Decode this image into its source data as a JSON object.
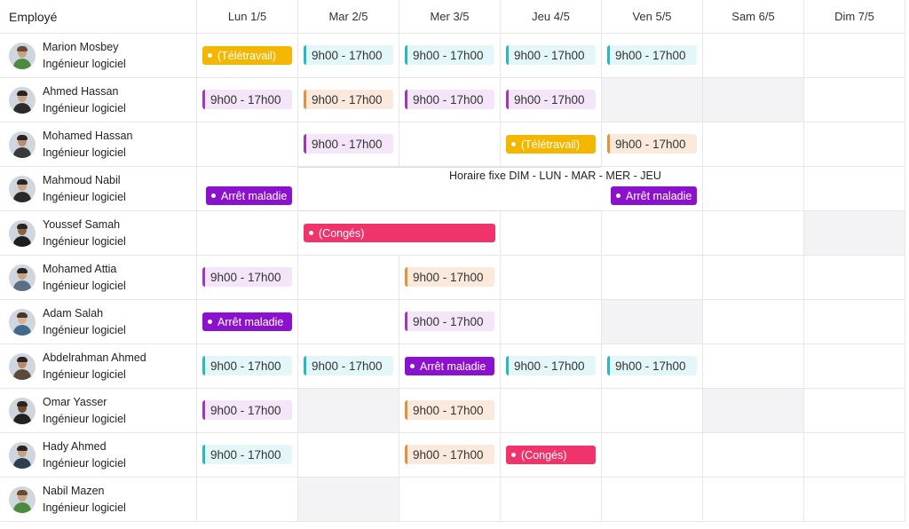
{
  "header": {
    "employee_label": "Employé",
    "days": [
      "Lun 1/5",
      "Mar 2/5",
      "Mer 3/5",
      "Jeu 4/5",
      "Ven 5/5",
      "Sam 6/5",
      "Dim 7/5"
    ]
  },
  "role": "Ingénieur logiciel",
  "employees": [
    {
      "name": "Marion Mosbey"
    },
    {
      "name": "Ahmed Hassan"
    },
    {
      "name": "Mohamed Hassan"
    },
    {
      "name": "Mahmoud Nabil"
    },
    {
      "name": "Youssef Samah"
    },
    {
      "name": "Mohamed Attia"
    },
    {
      "name": "Adam Salah"
    },
    {
      "name": "Abdelrahman Ahmed"
    },
    {
      "name": "Omar Yasser"
    },
    {
      "name": "Hady Ahmed"
    },
    {
      "name": "Nabil Mazen"
    }
  ],
  "labels": {
    "shift": "9h00 - 17h00",
    "telework": "(Télétravail)",
    "sick": "Arrêt maladie",
    "leave": "(Congés)",
    "fixed_schedule": "Horaire fixe DIM - LUN - MAR - MER - JEU"
  },
  "colors": {
    "shift_cyan": "#2bb7c2",
    "shift_purple": "#9b3ab5",
    "shift_orange": "#e0933d",
    "telework": "#f5b600",
    "sick": "#8a12cc",
    "leave": "#f0336a",
    "day_off": "#f3f3f6"
  }
}
